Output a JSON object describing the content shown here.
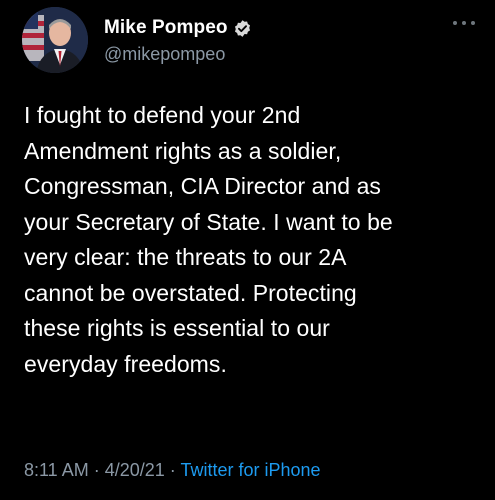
{
  "user": {
    "display_name": "Mike Pompeo",
    "handle": "@mikepompeo",
    "verified": true
  },
  "tweet": {
    "text": "I fought to defend your 2nd\nAmendment rights as a soldier,\nCongressman, CIA Director and as\nyour Secretary of State. I want to be\nvery clear: the threats to our 2A\ncannot be overstated. Protecting\nthese rights is essential to our\neveryday freedoms.",
    "time": "8:11 AM",
    "sep1": " · ",
    "date": "4/20/21",
    "sep2": " · ",
    "source": "Twitter for iPhone"
  },
  "icons": {
    "more": "more-dots-icon",
    "verified": "verified-badge-icon",
    "avatar": "profile-avatar"
  },
  "colors": {
    "background": "#000000",
    "text": "#ffffff",
    "secondary": "#8b98a5",
    "accent": "#1d9bf0"
  }
}
